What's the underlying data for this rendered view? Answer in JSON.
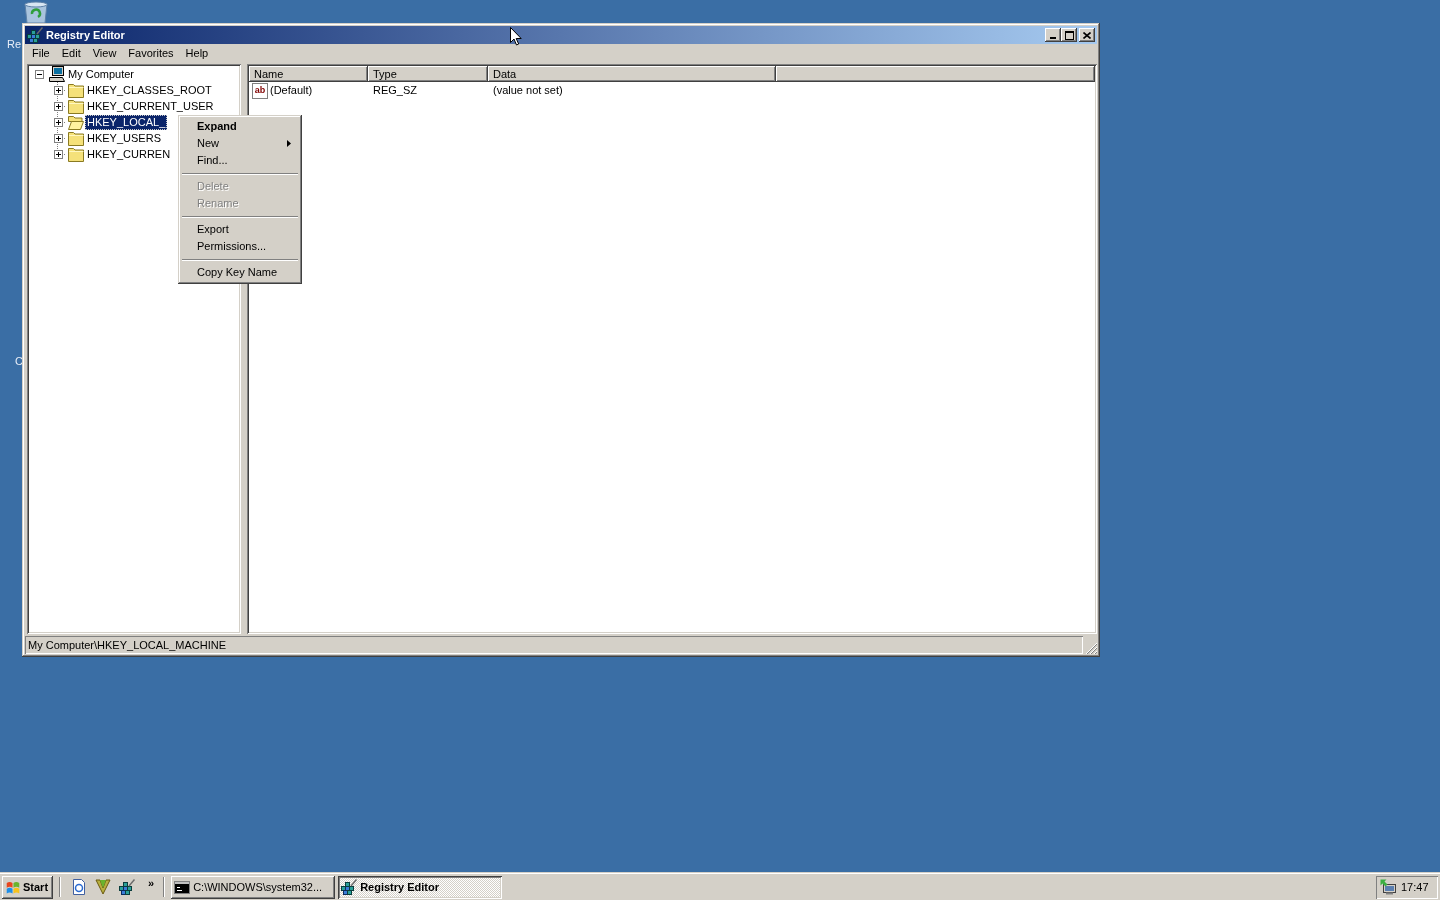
{
  "desktop_icons": [
    {
      "label": "Re"
    },
    {
      "label": "C"
    }
  ],
  "window": {
    "title": "Registry Editor"
  },
  "menu_bar": [
    {
      "label": "File"
    },
    {
      "label": "Edit"
    },
    {
      "label": "View"
    },
    {
      "label": "Favorites"
    },
    {
      "label": "Help"
    }
  ],
  "tree": {
    "items": [
      {
        "label": "My Computer",
        "kind": "computer",
        "expanded": true,
        "selected": false,
        "children": [
          {
            "label": "HKEY_CLASSES_ROOT",
            "kind": "folder",
            "expanded": false,
            "selected": false
          },
          {
            "label": "HKEY_CURRENT_USER",
            "kind": "folder",
            "expanded": false,
            "selected": false
          },
          {
            "label": "HKEY_LOCAL_",
            "kind": "folder",
            "expanded": false,
            "selected": true
          },
          {
            "label": "HKEY_USERS",
            "kind": "folder",
            "expanded": false,
            "selected": false
          },
          {
            "label": "HKEY_CURREN",
            "kind": "folder",
            "expanded": false,
            "selected": false
          }
        ]
      }
    ]
  },
  "list": {
    "columns": [
      {
        "label": "Name"
      },
      {
        "label": "Type"
      },
      {
        "label": "Data"
      }
    ],
    "rows": [
      {
        "name": "(Default)",
        "icon_text": "ab",
        "type": "REG_SZ",
        "data": "(value not set)",
        "selected": false
      }
    ]
  },
  "status_bar": {
    "text": "My Computer\\HKEY_LOCAL_MACHINE"
  },
  "context_menu": {
    "items": [
      {
        "kind": "command",
        "label": "Expand",
        "default": true,
        "disabled": false,
        "submenu": false
      },
      {
        "kind": "command",
        "label": "New",
        "default": false,
        "disabled": false,
        "submenu": true
      },
      {
        "kind": "command",
        "label": "Find...",
        "default": false,
        "disabled": false,
        "submenu": false
      },
      {
        "kind": "separator"
      },
      {
        "kind": "command",
        "label": "Delete",
        "default": false,
        "disabled": true,
        "submenu": false
      },
      {
        "kind": "command",
        "label": "Rename",
        "default": false,
        "disabled": true,
        "submenu": false
      },
      {
        "kind": "separator"
      },
      {
        "kind": "command",
        "label": "Export",
        "default": false,
        "disabled": false,
        "submenu": false
      },
      {
        "kind": "command",
        "label": "Permissions...",
        "default": false,
        "disabled": false,
        "submenu": false
      },
      {
        "kind": "separator"
      },
      {
        "kind": "command",
        "label": "Copy Key Name",
        "default": false,
        "disabled": false,
        "submenu": false
      }
    ]
  },
  "taskbar": {
    "start": {
      "label": "Start"
    },
    "quick_launch_more": "»",
    "tasks": [
      {
        "kind": "console",
        "label": "C:\\WINDOWS\\system32...",
        "selected": false
      },
      {
        "kind": "regedit",
        "label": "Registry Editor",
        "selected": true
      }
    ],
    "clock": "17:47"
  }
}
